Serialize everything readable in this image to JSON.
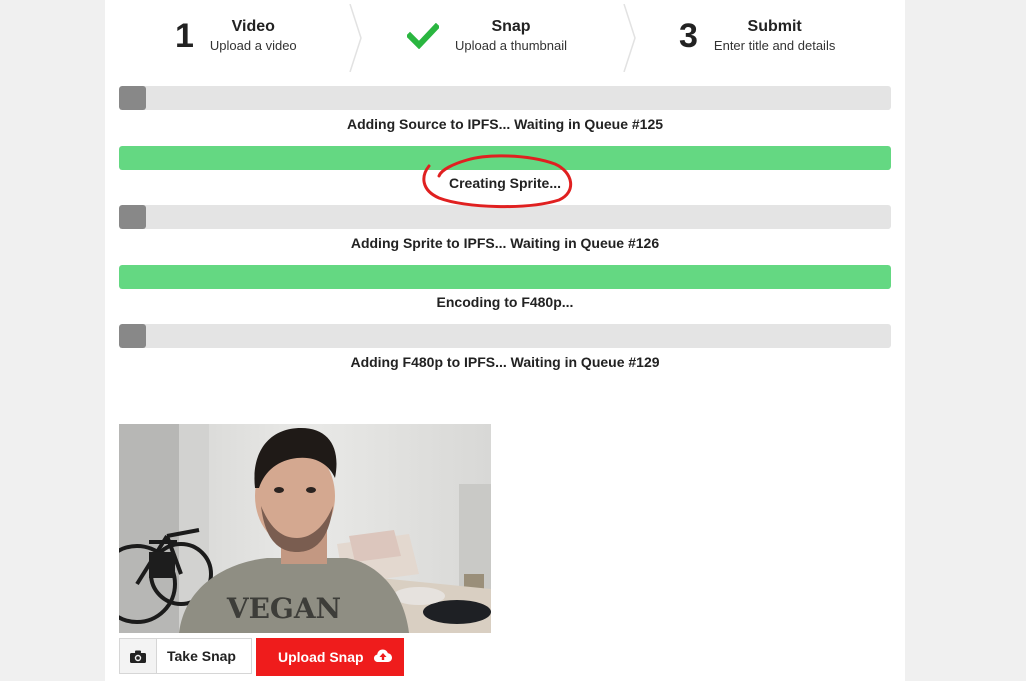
{
  "steps": [
    {
      "number": "1",
      "title": "Video",
      "subtitle": "Upload a video",
      "state": "pending"
    },
    {
      "number": "",
      "title": "Snap",
      "subtitle": "Upload a thumbnail",
      "state": "done",
      "icon": "checkmark-icon"
    },
    {
      "number": "3",
      "title": "Submit",
      "subtitle": "Enter title and details",
      "state": "pending"
    }
  ],
  "progress": [
    {
      "label": "Adding Source to IPFS... Waiting in Queue #125",
      "percent": 3.5,
      "color": "#888888"
    },
    {
      "label": "Creating Sprite...",
      "percent": 100,
      "color": "#64d882"
    },
    {
      "label": "Adding Sprite to IPFS... Waiting in Queue #126",
      "percent": 3.5,
      "color": "#888888"
    },
    {
      "label": "Encoding to F480p...",
      "percent": 100,
      "color": "#64d882"
    },
    {
      "label": "Adding F480p to IPFS... Waiting in Queue #129",
      "percent": 3.5,
      "color": "#888888"
    }
  ],
  "snapshot": {
    "shirt_text": "VEGAN"
  },
  "buttons": {
    "take_snap": "Take Snap",
    "upload_snap": "Upload Snap"
  },
  "colors": {
    "accent_red": "#ef1c1c",
    "progress_green": "#64d882",
    "progress_gray": "#888888",
    "check_green": "#2ab640",
    "annotation_red": "#e02020"
  },
  "icons": {
    "take_snap": "camera-icon",
    "upload_snap": "cloud-upload-icon"
  }
}
